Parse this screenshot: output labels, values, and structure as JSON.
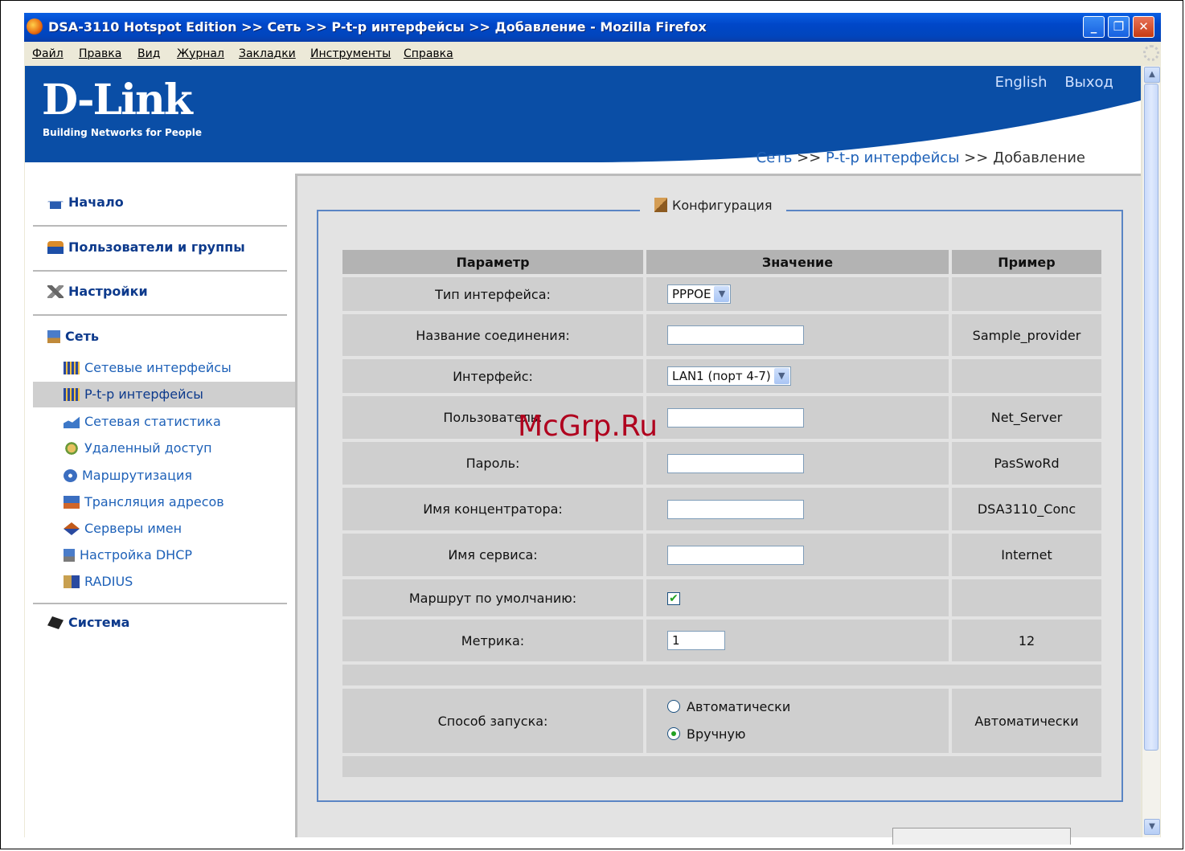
{
  "window": {
    "title": "DSA-3110 Hotspot Edition >> Сеть >> P-t-p интерфейсы >> Добавление - Mozilla Firefox",
    "minimize_glyph": "_",
    "restore_glyph": "❐",
    "close_glyph": "✕"
  },
  "menubar": {
    "items": [
      "Файл",
      "Правка",
      "Вид",
      "Журнал",
      "Закладки",
      "Инструменты",
      "Справка"
    ]
  },
  "header": {
    "logo": "D-Link",
    "tagline": "Building Networks for People",
    "lang_link": "English",
    "logout_link": "Выход"
  },
  "breadcrumb": {
    "part1": "Сеть",
    "sep": ">>",
    "part2": "P-t-p интерфейсы",
    "part3": "Добавление"
  },
  "sidebar": {
    "sections": [
      {
        "label": "Начало",
        "icon": "home-icon"
      },
      {
        "label": "Пользователи и группы",
        "icon": "users-icon"
      },
      {
        "label": "Настройки",
        "icon": "tools-icon"
      },
      {
        "label": "Сеть",
        "icon": "network-icon"
      },
      {
        "label": "Система",
        "icon": "system-icon"
      }
    ],
    "network_items": [
      {
        "label": "Сетевые интерфейсы",
        "icon": "network-card-icon"
      },
      {
        "label": "P-t-p интерфейсы",
        "icon": "network-card-icon",
        "active": true
      },
      {
        "label": "Сетевая статистика",
        "icon": "chart-icon"
      },
      {
        "label": "Удаленный доступ",
        "icon": "remote-access-icon"
      },
      {
        "label": "Маршрутизация",
        "icon": "routing-icon"
      },
      {
        "label": "Трансляция адресов",
        "icon": "nat-icon"
      },
      {
        "label": "Серверы имен",
        "icon": "dns-icon"
      },
      {
        "label": "Настройка DHCP",
        "icon": "dhcp-icon"
      },
      {
        "label": "RADIUS",
        "icon": "radius-icon"
      }
    ]
  },
  "config": {
    "legend": "Конфигурация",
    "headers": {
      "param": "Параметр",
      "value": "Значение",
      "example": "Пример"
    },
    "rows": {
      "iface_type": {
        "label": "Тип интерфейса:",
        "value": "PPPOE",
        "example": ""
      },
      "conn_name": {
        "label": "Название соединения:",
        "value": "",
        "example": "Sample_provider"
      },
      "interface": {
        "label": "Интерфейс:",
        "value": "LAN1 (порт 4-7)",
        "example": ""
      },
      "user": {
        "label": "Пользователь:",
        "value": "",
        "example": "Net_Server"
      },
      "password": {
        "label": "Пароль:",
        "value": "",
        "example": "PasSwoRd"
      },
      "concentrator": {
        "label": "Имя концентратора:",
        "value": "",
        "example": "DSA3110_Conc"
      },
      "service": {
        "label": "Имя сервиса:",
        "value": "",
        "example": "Internet"
      },
      "default_route": {
        "label": "Маршрут по умолчанию:",
        "checked": true,
        "check_glyph": "✔",
        "example": ""
      },
      "metric": {
        "label": "Метрика:",
        "value": "1",
        "example": "12"
      },
      "start_mode": {
        "label": "Способ запуска:",
        "options": [
          "Автоматически",
          "Вручную"
        ],
        "selected": "Вручную",
        "example": "Автоматически"
      }
    }
  },
  "watermark": "McGrp.Ru",
  "scrollbar": {
    "up_glyph": "▲",
    "down_glyph": "▼"
  }
}
